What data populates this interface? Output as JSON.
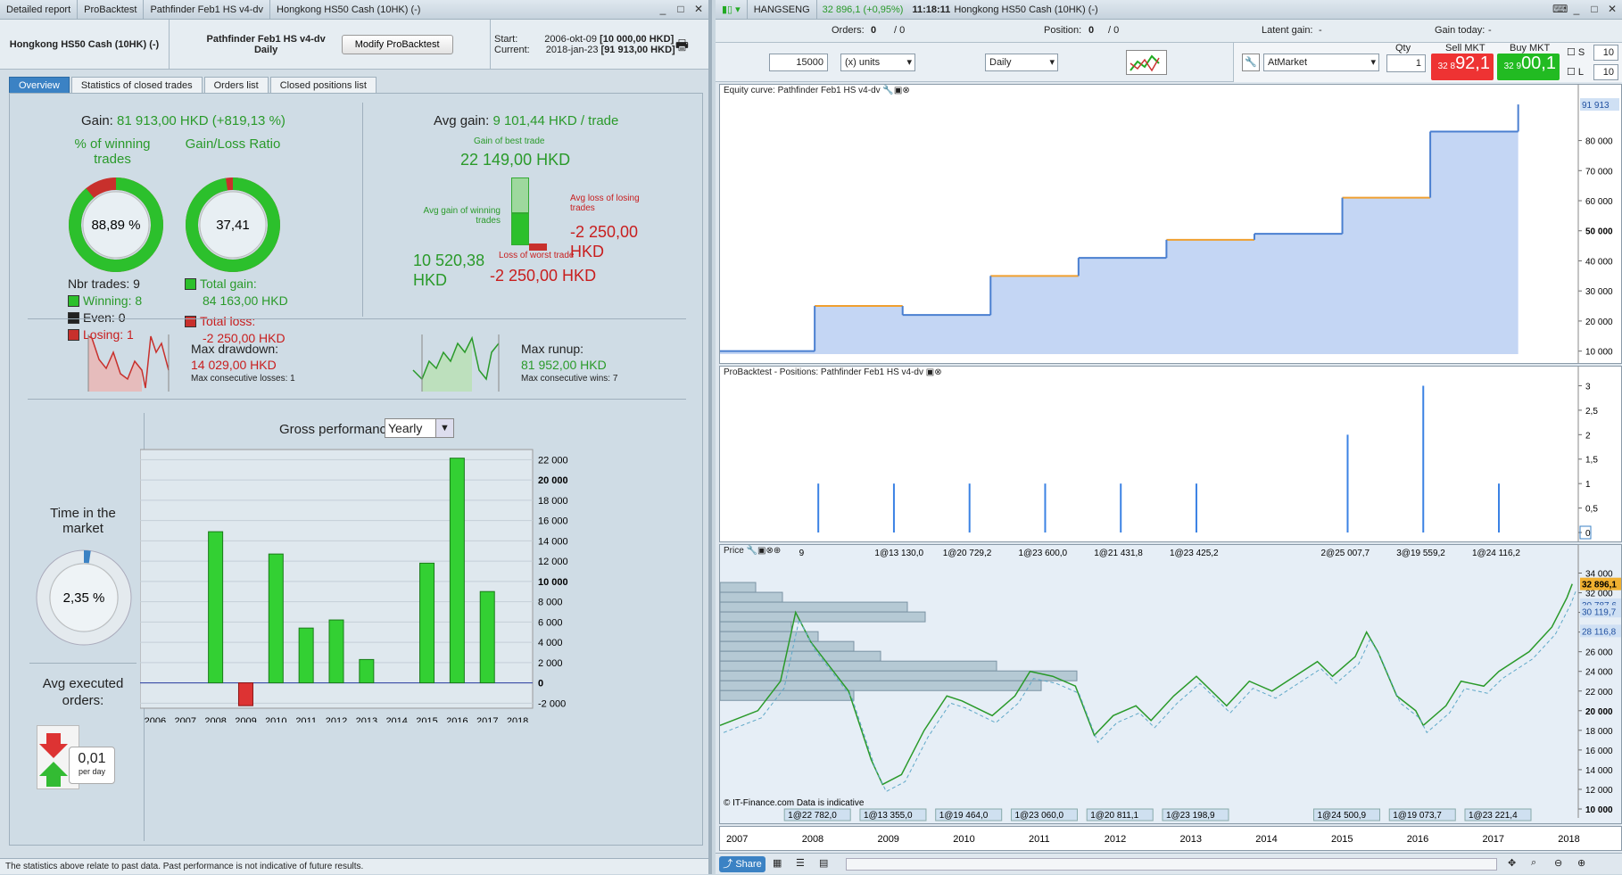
{
  "left_title": {
    "seg1": "Detailed report",
    "seg2": "ProBacktest",
    "seg3": "Pathfinder Feb1 HS v4-dv",
    "seg4": "Hongkong HS50 Cash (10HK) (-)"
  },
  "header": {
    "instrument": "Hongkong HS50 Cash (10HK) (-)",
    "system_name": "Pathfinder Feb1 HS v4-dv",
    "timeframe": "Daily",
    "modify_button": "Modify ProBacktest",
    "start_label": "Start:",
    "start_date": "2006-okt-09",
    "start_value": "[10 000,00 HKD]",
    "current_label": "Current:",
    "current_date": "2018-jan-23",
    "current_value": "[91 913,00 HKD]"
  },
  "tabs": [
    "Overview",
    "Statistics of closed trades",
    "Orders list",
    "Closed positions list"
  ],
  "overview": {
    "gain_label": "Gain:",
    "gain_value": "81 913,00 HKD (+819,13 %)",
    "winning_label": "% of winning trades",
    "winning_pct": "88,89 %",
    "winning_frac": 0.8889,
    "ratio_label": "Gain/Loss Ratio",
    "ratio_value": "37,41",
    "ratio_frac": 0.974,
    "nbr_trades": "Nbr trades: 9",
    "winning": "Winning: 8",
    "even": "Even: 0",
    "losing": "Losing: 1",
    "total_gain_label": "Total gain:",
    "total_gain": "84 163,00 HKD",
    "total_loss_label": "Total loss:",
    "total_loss": "-2 250,00 HKD",
    "avg_gain_label": "Avg gain:",
    "avg_gain": "9 101,44 HKD / trade",
    "best_label": "Gain of best trade",
    "best_value": "22 149,00 HKD",
    "avg_win_label": "Avg gain of winning trades",
    "avg_win_value": "10 520,38 HKD",
    "avg_loss_label": "Avg loss of losing trades",
    "avg_loss_value": "-2 250,00 HKD",
    "worst_label": "Loss of worst trade",
    "worst_value": "-2 250,00 HKD",
    "drawdown_label": "Max drawdown:",
    "drawdown_value": "14 029,00 HKD",
    "consec_losses": "Max consecutive losses: 1",
    "runup_label": "Max runup:",
    "runup_value": "81 952,00 HKD",
    "consec_wins": "Max consecutive wins: 7",
    "time_label": "Time in the market",
    "time_value": "2,35 %",
    "time_frac": 0.0235,
    "avg_orders_label": "Avg executed orders:",
    "avg_orders_value": "0,01",
    "per_day": "per day",
    "gross_label": "Gross performance",
    "gross_select": "Yearly",
    "disclaimer": "The statistics above relate to past data. Past performance is not indicative of future results."
  },
  "chart_data": {
    "type": "bar",
    "categories": [
      "2006",
      "2007",
      "2008",
      "2009",
      "2010",
      "2011",
      "2012",
      "2013",
      "2014",
      "2015",
      "2016",
      "2017",
      "2018"
    ],
    "values": [
      0,
      0,
      14900,
      -2250,
      12700,
      5400,
      6200,
      2300,
      0,
      11800,
      22149,
      9000,
      0
    ],
    "ylim": [
      -2500,
      23000
    ],
    "yticks": [
      "22 000",
      "20 000",
      "18 000",
      "16 000",
      "14 000",
      "12 000",
      "10 000",
      "8 000",
      "6 000",
      "4 000",
      "2 000",
      "0",
      "-2 000"
    ],
    "ytick_values": [
      22000,
      20000,
      18000,
      16000,
      14000,
      12000,
      10000,
      8000,
      6000,
      4000,
      2000,
      0,
      -2000
    ],
    "bold_ticks": [
      "20 000",
      "10 000",
      "0"
    ]
  },
  "right_title": {
    "symbol": "HANGSENG",
    "price": "32 896,1 (+0,95%)",
    "time": "11:18:11",
    "instrument": "Hongkong HS50 Cash (10HK) (-)"
  },
  "orders_bar": {
    "orders_label": "Orders:",
    "orders_value": "0",
    "orders_value2": "/ 0",
    "position_label": "Position:",
    "position_value": "0",
    "position_value2": "/ 0",
    "latent_label": "Latent gain:",
    "latent_value": "-",
    "today_label": "Gain today:",
    "today_value": "-"
  },
  "trade_bar": {
    "units_value": "15000",
    "units_label": "(x) units",
    "period": "Daily",
    "order_type": "AtMarket",
    "qty_label": "Qty",
    "qty_value": "1",
    "sell_label": "Sell MKT",
    "sell_small": "32 8",
    "sell_big": "92,1",
    "buy_label": "Buy MKT",
    "buy_small": "32 9",
    "buy_big": "00,1",
    "s_label": "S",
    "s_value": "10",
    "l_label": "L",
    "l_value": "10"
  },
  "equity": {
    "title": "Equity curve: Pathfinder Feb1 HS v4-dv",
    "last_label": "91 913",
    "yticks": [
      "80 000",
      "70 000",
      "60 000",
      "50 000",
      "40 000",
      "30 000",
      "20 000",
      "10 000"
    ],
    "ytick_values": [
      80000,
      70000,
      60000,
      50000,
      40000,
      30000,
      20000,
      10000
    ],
    "bold_ticks": [
      "50 000"
    ],
    "ymin": 9000,
    "ymax": 95000,
    "steps": [
      [
        0,
        10000
      ],
      [
        0.14,
        25000
      ],
      [
        0.27,
        22000
      ],
      [
        0.4,
        35000
      ],
      [
        0.53,
        41000
      ],
      [
        0.66,
        47000
      ],
      [
        0.79,
        49000
      ],
      [
        0.92,
        61000
      ],
      [
        1.05,
        83000
      ],
      [
        1.18,
        92000
      ]
    ]
  },
  "positions": {
    "title": "ProBacktest - Positions: Pathfinder Feb1 HS v4-dv",
    "yticks": [
      "3",
      "2,5",
      "2",
      "1,5",
      "1",
      "0,5",
      "0"
    ],
    "ytick_values": [
      3,
      2.5,
      2,
      1.5,
      1,
      0.5,
      0
    ],
    "ymin": 0,
    "ymax": 3.1,
    "bars": [
      [
        2008.1,
        1
      ],
      [
        2009.1,
        1
      ],
      [
        2010.1,
        1
      ],
      [
        2011.1,
        1
      ],
      [
        2012.1,
        1
      ],
      [
        2013.1,
        1
      ],
      [
        2015.1,
        2
      ],
      [
        2016.1,
        3
      ],
      [
        2017.1,
        1
      ]
    ]
  },
  "price": {
    "title": "Price",
    "last_label": "32 896,1",
    "labels_right": [
      "30 787,6",
      "30 119,7",
      "28 116,8"
    ],
    "yticks": [
      "34 000",
      "32 000",
      "30 000",
      "28 000",
      "26 000",
      "24 000",
      "22 000",
      "20 000",
      "18 000",
      "16 000",
      "14 000",
      "12 000",
      "10 000"
    ],
    "ytick_values": [
      34000,
      32000,
      30000,
      28000,
      26000,
      24000,
      22000,
      20000,
      18000,
      16000,
      14000,
      12000,
      10000
    ],
    "bold_ticks": [
      "20 000",
      "10 000"
    ],
    "ymin": 10000,
    "ymax": 34500,
    "top_tags": [
      {
        "text": "9",
        "x": 2008.2
      },
      {
        "text": "1@13 130,0",
        "x": 2009.2
      },
      {
        "text": "1@20 729,2",
        "x": 2010.1
      },
      {
        "text": "1@23 600,0",
        "x": 2011.1
      },
      {
        "text": "1@21 431,8",
        "x": 2012.1
      },
      {
        "text": "1@23 425,2",
        "x": 2013.1
      },
      {
        "text": "2@25 007,7",
        "x": 2015.1
      },
      {
        "text": "3@19 559,2",
        "x": 2016.1
      },
      {
        "text": "1@24 116,2",
        "x": 2017.1
      }
    ],
    "bottom_tags": [
      {
        "text": "1@22 782,0",
        "x": 2008.1
      },
      {
        "text": "1@13 355,0",
        "x": 2009.1
      },
      {
        "text": "1@19 464,0",
        "x": 2010.1
      },
      {
        "text": "1@23 060,0",
        "x": 2011.1
      },
      {
        "text": "1@20 811,1",
        "x": 2012.1
      },
      {
        "text": "1@23 198,9",
        "x": 2013.1
      },
      {
        "text": "1@24 500,9",
        "x": 2015.1
      },
      {
        "text": "1@19 073,7",
        "x": 2016.1
      },
      {
        "text": "1@23 221,4",
        "x": 2017.1
      }
    ],
    "xlabels": [
      "2007",
      "2008",
      "2009",
      "2010",
      "2011",
      "2012",
      "2013",
      "2014",
      "2015",
      "2016",
      "2017",
      "2018"
    ],
    "copyright": "© IT-Finance.com Data is indicative",
    "series": [
      [
        2006.8,
        18500
      ],
      [
        2007.3,
        20000
      ],
      [
        2007.6,
        23000
      ],
      [
        2007.8,
        30000
      ],
      [
        2008.0,
        27000
      ],
      [
        2008.3,
        24000
      ],
      [
        2008.5,
        22000
      ],
      [
        2008.8,
        15000
      ],
      [
        2008.95,
        12500
      ],
      [
        2009.2,
        13500
      ],
      [
        2009.5,
        18000
      ],
      [
        2009.8,
        21500
      ],
      [
        2010.0,
        21000
      ],
      [
        2010.4,
        19500
      ],
      [
        2010.7,
        21500
      ],
      [
        2010.9,
        24000
      ],
      [
        2011.2,
        23500
      ],
      [
        2011.5,
        22500
      ],
      [
        2011.75,
        17500
      ],
      [
        2012.0,
        19500
      ],
      [
        2012.3,
        20500
      ],
      [
        2012.5,
        19000
      ],
      [
        2012.8,
        21500
      ],
      [
        2013.1,
        23500
      ],
      [
        2013.5,
        20500
      ],
      [
        2013.8,
        23000
      ],
      [
        2014.1,
        22000
      ],
      [
        2014.4,
        23500
      ],
      [
        2014.7,
        25000
      ],
      [
        2014.9,
        23500
      ],
      [
        2015.2,
        25500
      ],
      [
        2015.35,
        28000
      ],
      [
        2015.5,
        26000
      ],
      [
        2015.75,
        21500
      ],
      [
        2016.0,
        20000
      ],
      [
        2016.1,
        18500
      ],
      [
        2016.4,
        20500
      ],
      [
        2016.6,
        23000
      ],
      [
        2016.9,
        22500
      ],
      [
        2017.1,
        24000
      ],
      [
        2017.5,
        26000
      ],
      [
        2017.8,
        28500
      ],
      [
        2018.0,
        31500
      ],
      [
        2018.07,
        32896
      ]
    ]
  },
  "bottom": {
    "share": "Share"
  }
}
